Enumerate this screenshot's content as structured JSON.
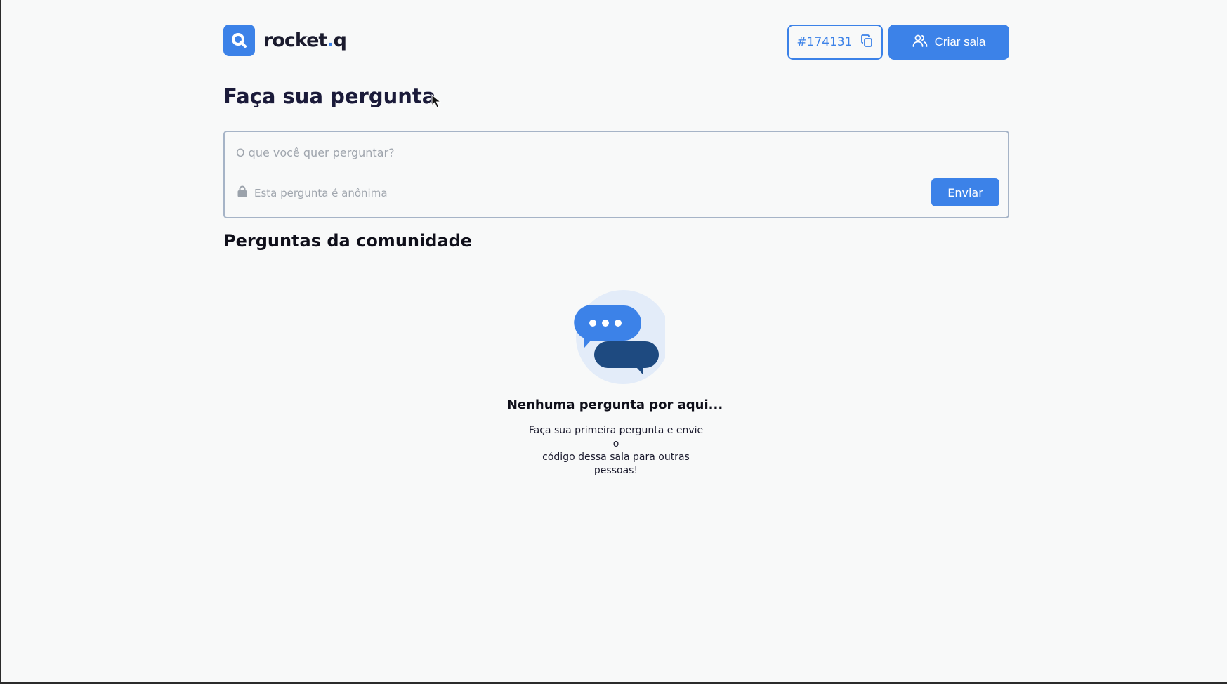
{
  "header": {
    "logo_text_main": "rocket",
    "logo_text_dot": ".",
    "logo_text_end": "q",
    "room_code": "#174131",
    "create_room_label": "Criar sala"
  },
  "page": {
    "title": "Faça sua pergunta"
  },
  "form": {
    "question_placeholder": "O que você quer perguntar?",
    "question_value": "",
    "anonymous_label": "Esta pergunta é anônima",
    "send_label": "Enviar"
  },
  "community": {
    "title": "Perguntas da comunidade",
    "empty_title": "Nenhuma pergunta por aqui...",
    "empty_line1": "Faça sua primeira pergunta e envie o",
    "empty_line2": "código dessa sala para outras pessoas!"
  },
  "colors": {
    "accent": "#3c82e8",
    "dark_bubble": "#1e4a80",
    "background": "#f8f9f9"
  },
  "icons": {
    "logo": "search-logo-icon",
    "copy": "copy-icon",
    "users": "users-icon",
    "lock": "lock-icon",
    "empty": "chat-bubbles-icon"
  }
}
